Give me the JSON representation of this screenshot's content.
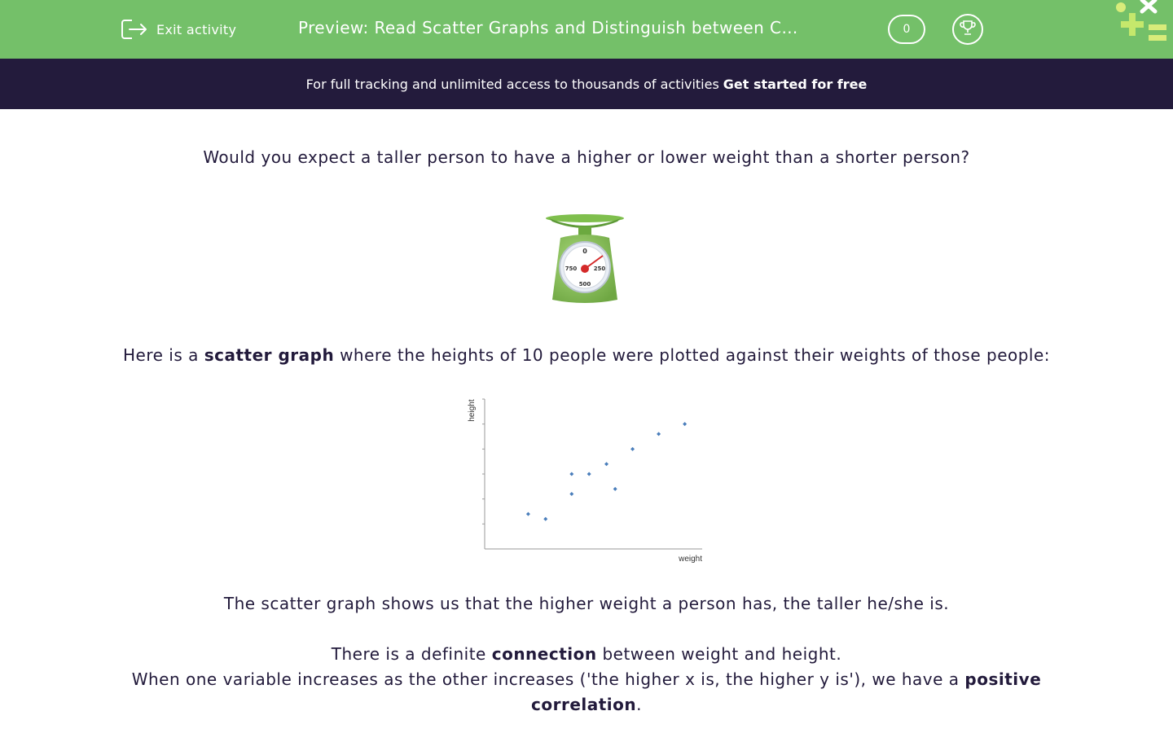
{
  "header": {
    "exit_label": "Exit activity",
    "title": "Preview: Read Scatter Graphs and Distinguish between C…",
    "score": "0"
  },
  "banner": {
    "text": "For full tracking and unlimited access to thousands of activities",
    "link": "Get started for free"
  },
  "content": {
    "question": "Would you expect a taller person to have a higher or lower weight than a shorter person?",
    "scale_dial": {
      "top": "0",
      "left": "750",
      "right": "250",
      "bottom": "500"
    },
    "intro": {
      "before": "Here is a",
      "bold": "scatter graph",
      "after": "where the heights of 10 people were plotted against their weights of those people:"
    },
    "shows": "The scatter graph shows us that the higher weight a person has, the taller he/she is.",
    "connection": {
      "before": "There is a definite",
      "bold": "connection",
      "after": "between weight and height."
    },
    "correlation": {
      "before": "When one variable increases as the other increases ('the higher x is, the higher y is'), we have a",
      "bold": "positive correlation",
      "after": "."
    }
  },
  "chart_data": {
    "type": "scatter",
    "xlabel": "weight",
    "ylabel": "height",
    "xlim": [
      0,
      10
    ],
    "ylim": [
      0,
      6
    ],
    "grid": false,
    "points": [
      {
        "x": 2.0,
        "y": 1.4
      },
      {
        "x": 2.8,
        "y": 1.2
      },
      {
        "x": 4.0,
        "y": 2.2
      },
      {
        "x": 4.0,
        "y": 3.0
      },
      {
        "x": 4.8,
        "y": 3.0
      },
      {
        "x": 5.6,
        "y": 3.4
      },
      {
        "x": 6.0,
        "y": 2.4
      },
      {
        "x": 6.8,
        "y": 4.0
      },
      {
        "x": 8.0,
        "y": 4.6
      },
      {
        "x": 9.2,
        "y": 5.0
      }
    ],
    "color": "#4a7ebb"
  },
  "colors": {
    "header_bg": "#74c069",
    "banner_bg": "#231b3c",
    "text": "#221a3b",
    "logo_light": "#d8ec7a",
    "logo_dark": "#c5e86c"
  }
}
